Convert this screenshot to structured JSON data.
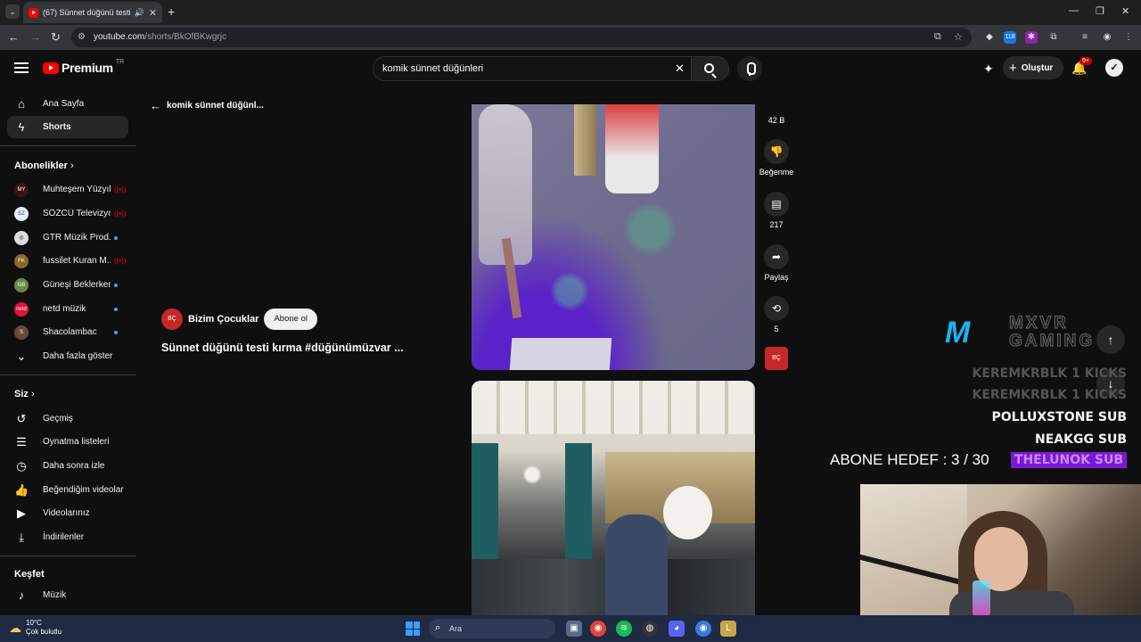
{
  "browser": {
    "tab_title": "(67) Sünnet düğünü testi k",
    "url_domain": "youtube.com",
    "url_path": "/shorts/BkOfBKwgrjc",
    "ext_badge": "118",
    "colors": {
      "tabbar": "#1f1f1f",
      "omnibox": "#202124"
    }
  },
  "header": {
    "brand": "Premium",
    "country": "TR",
    "search_value": "komik sünnet düğünleri",
    "create_label": "Oluştur",
    "notifications": "9+",
    "colors": {
      "brand_red": "#ff0000"
    }
  },
  "sidebar": {
    "home": "Ana Sayfa",
    "shorts": "Shorts",
    "subs_title": "Abonelikler",
    "subscriptions": [
      {
        "name": "Muhteşem Yüzyıl",
        "status": "live"
      },
      {
        "name": "SÖZCÜ Televizyo...",
        "status": "live"
      },
      {
        "name": "GTR Müzik Prod...",
        "status": "new"
      },
      {
        "name": "fussilet Kuran M...",
        "status": "live"
      },
      {
        "name": "Güneşi Beklerken",
        "status": "new"
      },
      {
        "name": "netd müzik",
        "status": "new"
      },
      {
        "name": "Shacolambac",
        "status": "new"
      }
    ],
    "show_more": "Daha fazla göster",
    "you_title": "Siz",
    "you_items": [
      "Geçmiş",
      "Oynatma listeleri",
      "Daha sonra izle",
      "Beğendiğim videolar",
      "Videolarınız",
      "İndirilenler"
    ],
    "explore_title": "Keşfet",
    "explore_items": [
      "Müzik"
    ]
  },
  "short": {
    "back_label": "komik sünnet düğünl...",
    "channel": "Bizim Çocuklar",
    "subscribe": "Abone ol",
    "title": "Sünnet düğünü testi kırma #düğünümüzvar ...",
    "likes": "42 B",
    "dislike_label": "Beğenme",
    "comments": "217",
    "share_label": "Paylaş",
    "remix_count": "5"
  },
  "overlay": {
    "logo_top": "MXVR",
    "logo_bottom": "GAMING",
    "alerts": [
      {
        "text": "KEREMKRBLK 1 KICKS",
        "style": "dim"
      },
      {
        "text": "KEREMKRBLK 1 KICKS",
        "style": "dim"
      },
      {
        "text": "POLLUXSTONE SUB",
        "style": "white"
      },
      {
        "text": "NEAKGG SUB",
        "style": "white"
      },
      {
        "text": "THELUNOK SUB",
        "style": "purple"
      }
    ],
    "goal": "ABONE HEDEF : 3 / 30"
  },
  "taskbar": {
    "temp": "10°C",
    "weather": "Çok bulutlu",
    "search": "Ara"
  }
}
